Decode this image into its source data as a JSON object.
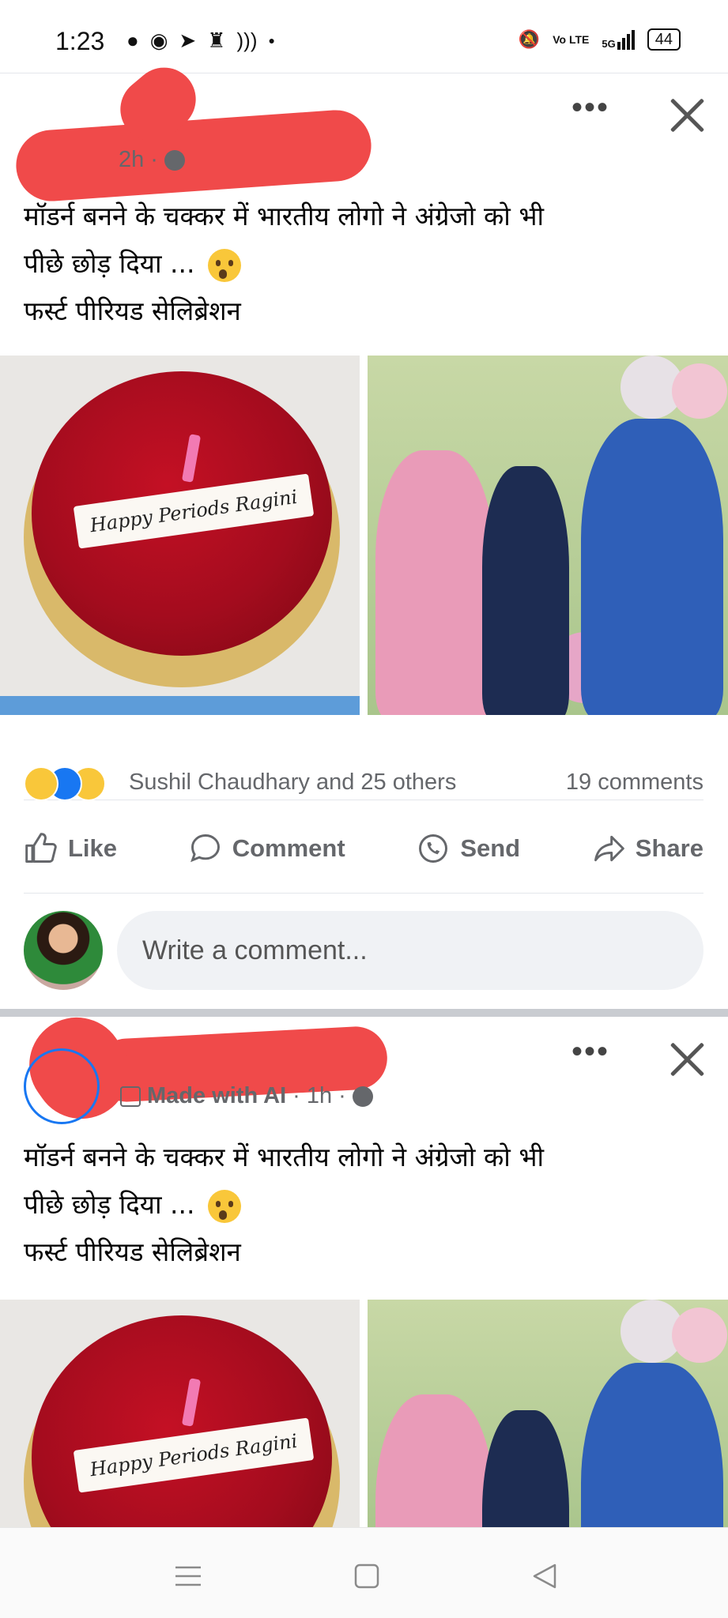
{
  "status_bar": {
    "time": "1:23",
    "icons_left": [
      "chat-bubble-icon",
      "messenger-icon",
      "telegram-icon",
      "trophy-icon",
      "wifi-call-icon",
      "dot-icon"
    ],
    "network": "5G",
    "volte": "Vo LTE",
    "battery": "44"
  },
  "posts": [
    {
      "meta_time": "2h",
      "text_lines": [
        "मॉडर्न बनने के चक्कर में भारतीय लोगो ने अंग्रेजो को भी",
        "पीछे छोड़ दिया ...",
        "फर्स्ट पीरियड सेलिब्रेशन"
      ],
      "cake_label": "Happy Periods Ragini",
      "reactions_text": "Sushil Chaudhary and 25 others",
      "comments_count": "19 comments"
    },
    {
      "made_with_ai": "Made with AI",
      "meta_time": "1h",
      "text_lines": [
        "मॉडर्न बनने के चक्कर में भारतीय लोगो ने अंग्रेजो को भी",
        "पीछे छोड़ दिया ...",
        "फर्स्ट पीरियड सेलिब्रेशन"
      ],
      "cake_label": "Happy Periods Ragini"
    }
  ],
  "actions": {
    "like": "Like",
    "comment": "Comment",
    "send": "Send",
    "share": "Share"
  },
  "comment_input": {
    "placeholder": "Write a comment..."
  },
  "colors": {
    "redaction": "#f04a4a",
    "reaction_haha": "#f9c73a",
    "reaction_like": "#1877f2",
    "secondary_text": "#65676b"
  }
}
